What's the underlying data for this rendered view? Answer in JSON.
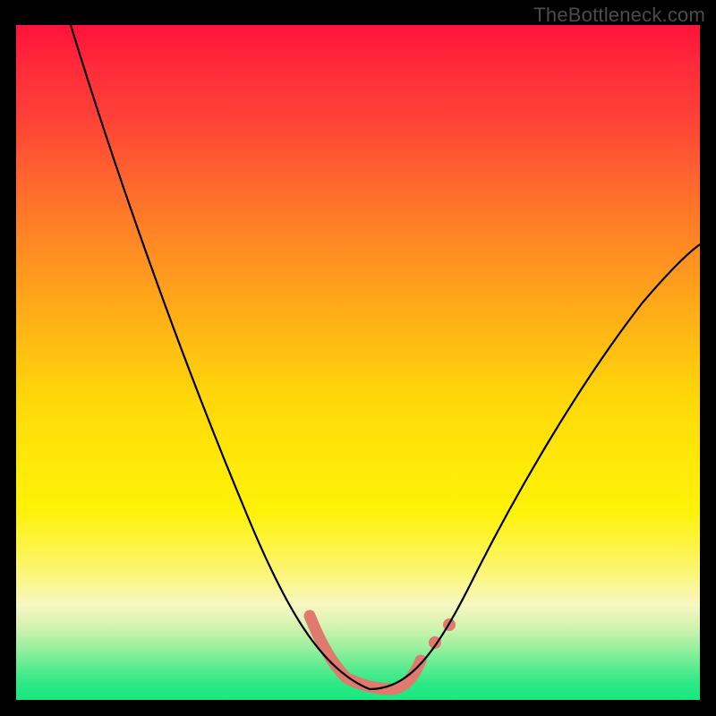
{
  "watermark": "TheBottleneck.com",
  "chart_data": {
    "type": "line",
    "title": "",
    "xlabel": "",
    "ylabel": "",
    "xlim": [
      0,
      100
    ],
    "ylim": [
      0,
      100
    ],
    "grid": false,
    "legend": false,
    "series": [
      {
        "name": "bottleneck-curve",
        "x": [
          8,
          12,
          16,
          20,
          24,
          28,
          32,
          36,
          40,
          43,
          46,
          49,
          52,
          55,
          58,
          62,
          66,
          70,
          75,
          80,
          86,
          92,
          98
        ],
        "values": [
          100,
          90,
          80,
          70,
          60,
          50,
          40,
          30,
          20,
          12,
          6,
          2,
          0.8,
          0.8,
          2,
          6,
          12,
          20,
          30,
          40,
          50,
          58,
          64
        ]
      }
    ],
    "highlight": {
      "name": "optimal-range",
      "segment_x": [
        43,
        58
      ],
      "dots_x": [
        61,
        63
      ]
    },
    "gradient_stops_pct_from_top_to_color": [
      [
        0,
        "#ff133b"
      ],
      [
        14,
        "#ff4237"
      ],
      [
        34,
        "#ff8f22"
      ],
      [
        55,
        "#ffd60a"
      ],
      [
        72,
        "#fff208"
      ],
      [
        86,
        "#f7f7c3"
      ],
      [
        92,
        "#9ef0a0"
      ],
      [
        100,
        "#18e880"
      ]
    ]
  }
}
